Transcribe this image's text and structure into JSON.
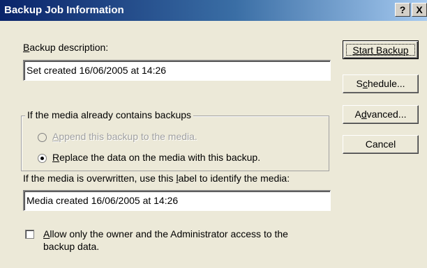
{
  "window": {
    "title": "Backup Job Information",
    "help_button": "?",
    "close_button": "X"
  },
  "description": {
    "label_prefix": "",
    "label_accel": "B",
    "label_rest": "ackup description:",
    "value": "Set created 16/06/2005 at 14:26"
  },
  "media_group": {
    "legend": "If the media already contains backups",
    "options": [
      {
        "accel": "A",
        "rest": "ppend this backup to the media.",
        "selected": false,
        "enabled": false
      },
      {
        "accel": "R",
        "rest": "eplace the data on the media with this backup.",
        "selected": true,
        "enabled": true
      }
    ]
  },
  "label_field": {
    "label_prefix": "If the media is overwritten, use this ",
    "label_accel": "l",
    "label_rest": "abel to identify the media:",
    "value": "Media created 16/06/2005 at 14:26"
  },
  "restrict_access": {
    "checked": false,
    "accel": "A",
    "line1_rest": "llow only the owner and the Administrator access to the",
    "line2": "backup data."
  },
  "buttons": {
    "start_backup": "Start Backup",
    "schedule_pre": "S",
    "schedule_accel": "c",
    "schedule_rest": "hedule...",
    "advanced_pre": "A",
    "advanced_accel": "d",
    "advanced_rest": "vanced...",
    "cancel": "Cancel"
  }
}
